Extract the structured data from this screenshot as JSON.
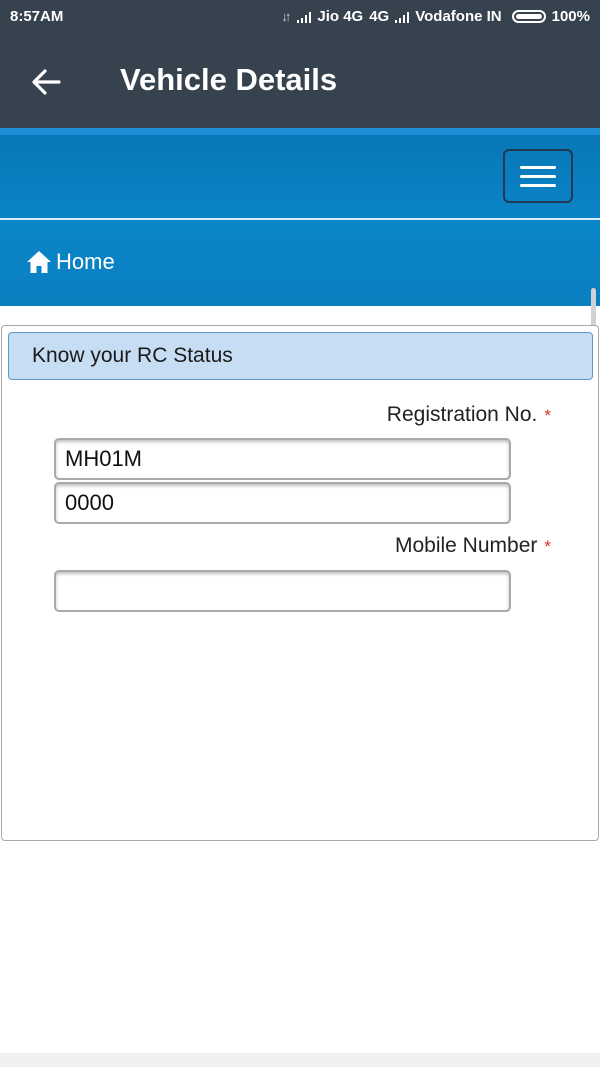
{
  "status_bar": {
    "time": "8:57AM",
    "carrier1": "Jio 4G",
    "network2": "4G",
    "carrier2": "Vodafone IN",
    "battery": "100%"
  },
  "app_bar": {
    "title": "Vehicle Details"
  },
  "breadcrumb": {
    "home_label": "Home"
  },
  "card": {
    "heading": "Know your RC Status",
    "registration": {
      "label": "Registration No.",
      "required_mark": "*",
      "part1_value": "MH01M",
      "part2_value": "0000"
    },
    "mobile": {
      "label": "Mobile Number",
      "required_mark": "*",
      "value": ""
    }
  },
  "colors": {
    "app_bar": "#37424f",
    "header_blue": "#0a84c7",
    "accent_blue": "#1f8fd8",
    "heading_bg": "#c6ddf3",
    "required": "#d9302c"
  },
  "icons": {
    "back": "arrow-left-icon",
    "menu": "hamburger-icon",
    "home": "home-icon",
    "signal": "signal-bars-icon",
    "battery": "battery-icon"
  }
}
